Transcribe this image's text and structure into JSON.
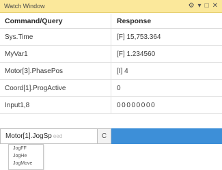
{
  "window": {
    "title": "Watch Window",
    "controls": {
      "pin": "⚙",
      "dropdown": "▾",
      "maximize": "□",
      "close": "✕"
    }
  },
  "table": {
    "headers": {
      "command": "Command/Query",
      "response": "Response"
    },
    "rows": [
      {
        "command": "Sys.Time",
        "response": "[F] 15,753.364"
      },
      {
        "command": "MyVar1",
        "response": "[F] 1.234560"
      },
      {
        "command": "Motor[3].PhasePos",
        "response": "[I] 4"
      },
      {
        "command": "Coord[1].ProgActive",
        "response": "0"
      },
      {
        "command": "Input1,8",
        "response": "00000000"
      }
    ]
  },
  "editor": {
    "value": "Motor[1].JogSp",
    "ghost_text": "eed",
    "button_label": "C"
  },
  "autocomplete": {
    "items": [
      "JogFF",
      "JogHe",
      "JogMove"
    ]
  },
  "colors": {
    "titlebar": "#fbe89b",
    "selection": "#3d8fd8"
  }
}
